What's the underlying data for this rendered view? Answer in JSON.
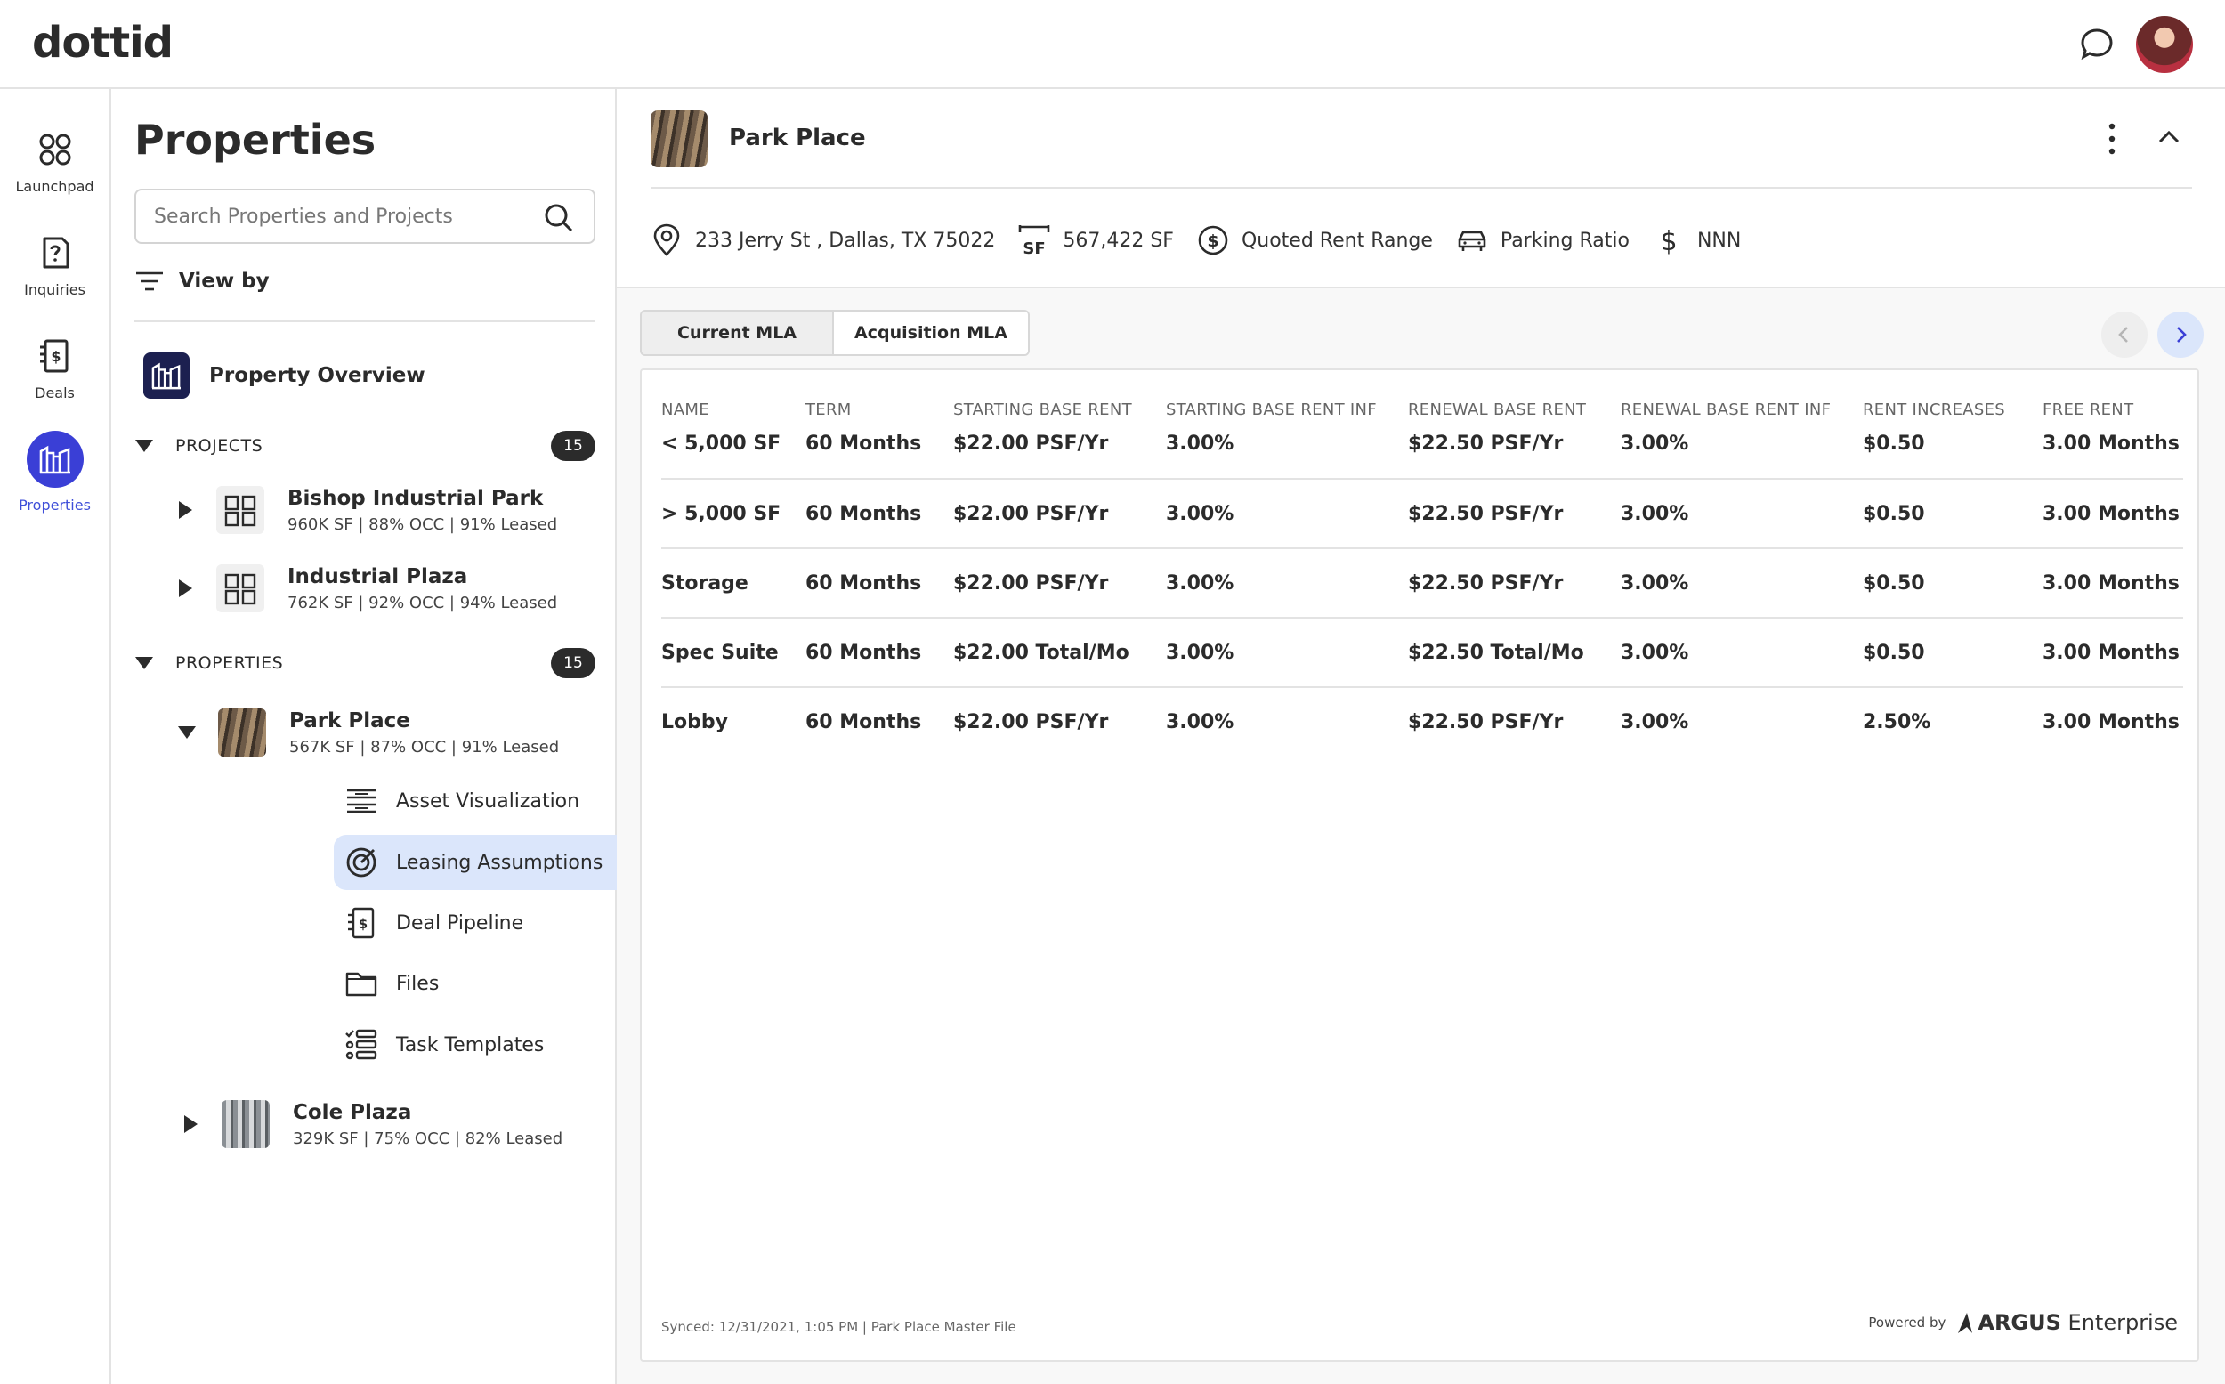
{
  "app": {
    "logo": "dottid"
  },
  "header": {
    "chat_icon": "chat-bubble-icon",
    "avatar_alt": "user-avatar"
  },
  "rail": {
    "items": [
      {
        "label": "Launchpad",
        "icon": "grid-icon"
      },
      {
        "label": "Inquiries",
        "icon": "question-doc-icon"
      },
      {
        "label": "Deals",
        "icon": "dollar-doc-icon"
      },
      {
        "label": "Properties",
        "icon": "buildings-icon",
        "active": true
      }
    ]
  },
  "sidebar": {
    "title": "Properties",
    "search_placeholder": "Search Properties and Projects",
    "view_by": "View by",
    "overview": "Property Overview",
    "projects_section": {
      "label": "PROJECTS",
      "count": "15"
    },
    "projects": [
      {
        "name": "Bishop Industrial Park",
        "meta": "960K SF | 88% OCC | 91% Leased"
      },
      {
        "name": "Industrial Plaza",
        "meta": "762K SF | 92% OCC | 94% Leased"
      }
    ],
    "properties_section": {
      "label": "PROPERTIES",
      "count": "15"
    },
    "properties": [
      {
        "name": "Park Place",
        "meta": "567K SF | 87% OCC | 91% Leased"
      },
      {
        "name": "Cole Plaza",
        "meta": "329K SF | 75% OCC | 82% Leased"
      }
    ],
    "sub_items": [
      {
        "label": "Asset Visualization",
        "icon": "lines-icon"
      },
      {
        "label": "Leasing Assumptions",
        "icon": "target-icon",
        "active": true
      },
      {
        "label": "Deal Pipeline",
        "icon": "dollar-doc-icon"
      },
      {
        "label": "Files",
        "icon": "folder-icon"
      },
      {
        "label": "Task Templates",
        "icon": "checklist-icon"
      }
    ]
  },
  "main": {
    "title": "Park Place",
    "meta": {
      "address": "233 Jerry St , Dallas, TX 75022",
      "sf": "567,422 SF",
      "rent": "Quoted Rent Range",
      "parking": "Parking Ratio",
      "lease_type": "NNN"
    },
    "tabs": [
      "Current MLA",
      "Acquisition MLA"
    ],
    "table": {
      "headers": [
        "NAME",
        "TERM",
        "STARTING BASE RENT",
        "STARTING BASE RENT INF",
        "RENEWAL BASE RENT",
        "RENEWAL BASE RENT INF",
        "RENT INCREASES",
        "FREE RENT"
      ],
      "rows": [
        [
          "< 5,000 SF",
          "60 Months",
          "$22.00 PSF/Yr",
          "3.00%",
          "$22.50 PSF/Yr",
          "3.00%",
          "$0.50",
          "3.00 Months"
        ],
        [
          "> 5,000 SF",
          "60 Months",
          "$22.00 PSF/Yr",
          "3.00%",
          "$22.50 PSF/Yr",
          "3.00%",
          "$0.50",
          "3.00 Months"
        ],
        [
          "Storage",
          "60 Months",
          "$22.00 PSF/Yr",
          "3.00%",
          "$22.50 PSF/Yr",
          "3.00%",
          "$0.50",
          "3.00 Months"
        ],
        [
          "Spec Suite",
          "60 Months",
          "$22.00 Total/Mo",
          "3.00%",
          "$22.50 Total/Mo",
          "3.00%",
          "$0.50",
          "3.00 Months"
        ],
        [
          "Lobby",
          "60 Months",
          "$22.00 PSF/Yr",
          "3.00%",
          "$22.50 PSF/Yr",
          "3.00%",
          "2.50%",
          "3.00 Months"
        ]
      ]
    },
    "footer": {
      "synced": "Synced: 12/31/2021, 1:05 PM  |  Park Place Master File",
      "powered_by": "Powered by",
      "brand_bold": "ARGUS",
      "brand_rest": " Enterprise"
    }
  },
  "colors": {
    "accent": "#3a3fd6",
    "active_bg": "#dbe6fb",
    "dark": "#2b2b2b"
  }
}
